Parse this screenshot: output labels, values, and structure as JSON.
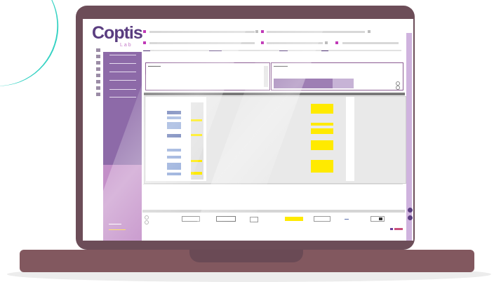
{
  "app": {
    "logo_text": "Coptis",
    "logo_subtext": "Lab"
  },
  "colors": {
    "brand_purple": "#5a3d80",
    "sidebar_purple": "#8d6aa8",
    "accent_pink": "#c47ac8",
    "highlight_yellow": "#ffea00",
    "laptop_frame": "#6c4d58",
    "accent_teal": "#35d2c3"
  },
  "icons": [
    "laptop-icon",
    "sidebar-nav-icon",
    "grid-icon"
  ]
}
